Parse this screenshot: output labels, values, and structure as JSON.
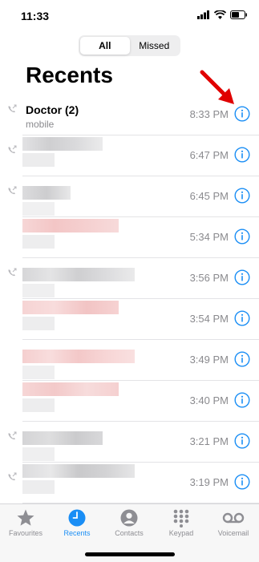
{
  "status": {
    "time": "11:33"
  },
  "segments": {
    "all": "All",
    "missed": "Missed"
  },
  "title": "Recents",
  "calls": [
    {
      "name": "Doctor (2)",
      "type": "mobile",
      "time": "8:33 PM"
    },
    {
      "name": "",
      "type": "",
      "time": "6:47 PM"
    },
    {
      "name": "",
      "type": "",
      "time": "6:45 PM"
    },
    {
      "name": "",
      "type": "",
      "time": "5:34 PM"
    },
    {
      "name": "",
      "type": "",
      "time": "3:56 PM"
    },
    {
      "name": "",
      "type": "",
      "time": "3:54 PM"
    },
    {
      "name": "",
      "type": "",
      "time": "3:49 PM"
    },
    {
      "name": "",
      "type": "",
      "time": "3:40 PM"
    },
    {
      "name": "",
      "type": "",
      "time": "3:21 PM"
    },
    {
      "name": "",
      "type": "",
      "time": "3:19 PM"
    }
  ],
  "tabs": [
    "Favourites",
    "Recents",
    "Contacts",
    "Keypad",
    "Voicemail"
  ],
  "colors": {
    "accent": "#1a8ef5",
    "annotation_arrow": "#e00000"
  }
}
